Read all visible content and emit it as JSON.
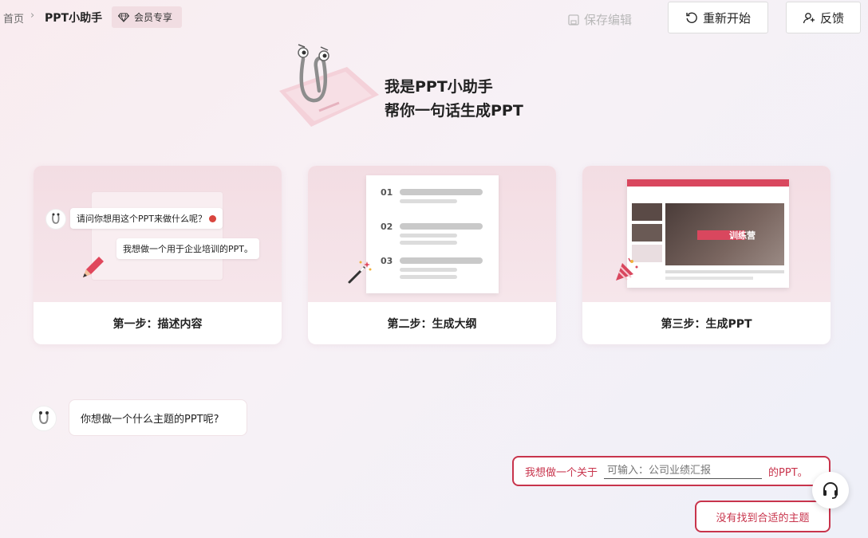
{
  "breadcrumb": {
    "home": "首页",
    "separator": "›",
    "current": "PPT小助手"
  },
  "vip": {
    "icon": "diamond-icon",
    "label": "会员专享"
  },
  "toolbar": {
    "save_label": "保存编辑",
    "save_icon": "floppy-disk-icon",
    "restart_label": "重新开始",
    "restart_icon": "refresh-icon",
    "feedback_label": "反馈",
    "feedback_icon": "feedback-user-icon"
  },
  "hero": {
    "line1": "我是PPT小助手",
    "line2": "帮你一句话生成PPT"
  },
  "steps": [
    {
      "label": "第一步：描述内容",
      "chat_question": "请问你想用这个PPT来做什么呢？",
      "chat_answer": "我想做一个用于企业培训的PPT。"
    },
    {
      "label": "第二步：生成大纲",
      "outline_numbers": [
        "01",
        "02",
        "03"
      ]
    },
    {
      "label": "第三步：生成PPT",
      "slide_title": "训练营"
    }
  ],
  "chat": {
    "bot_question": "你想做一个什么主题的PPT呢?"
  },
  "input": {
    "prefix": "我想做一个关于",
    "placeholder": "可输入：公司业绩汇报",
    "suffix": "的PPT。"
  },
  "not_found_label": "没有找到合适的主题",
  "colors": {
    "accent": "#c8344c",
    "card_bg": "#f3dde3"
  }
}
